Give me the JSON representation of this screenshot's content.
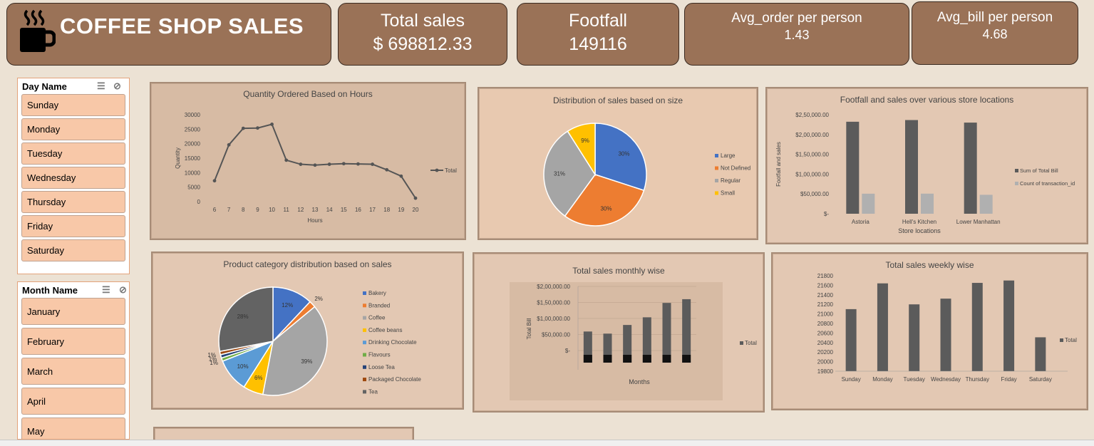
{
  "header": {
    "title": "COFFEE SHOP SALES",
    "kpis": [
      {
        "label": "Total sales",
        "value": "$ 698812.33"
      },
      {
        "label": "Footfall",
        "value": "149116"
      },
      {
        "label": "Avg_order per person",
        "value": "1.43"
      },
      {
        "label": "Avg_bill per person",
        "value": "4.68"
      }
    ]
  },
  "slicers": {
    "day": {
      "title": "Day Name",
      "items": [
        "Sunday",
        "Monday",
        "Tuesday",
        "Wednesday",
        "Thursday",
        "Friday",
        "Saturday"
      ]
    },
    "month": {
      "title": "Month Name",
      "items": [
        "January",
        "February",
        "March",
        "April",
        "May"
      ]
    }
  },
  "chart_data": [
    {
      "id": "hours",
      "type": "line",
      "title": "Quantity Ordered Based on Hours",
      "xlabel": "Hours",
      "ylabel": "Quantity",
      "x": [
        6,
        7,
        8,
        9,
        10,
        11,
        12,
        13,
        14,
        15,
        16,
        17,
        18,
        19,
        20
      ],
      "series": [
        {
          "name": "Total",
          "values": [
            7200,
            19600,
            25300,
            25400,
            26700,
            14300,
            12900,
            12600,
            12900,
            13100,
            13000,
            12900,
            11000,
            8800,
            1200
          ]
        }
      ],
      "ylim": [
        0,
        30000
      ],
      "yticks": [
        "30000",
        "25000",
        "20000",
        "15000",
        "10000",
        "5000",
        "0"
      ],
      "legend": "right"
    },
    {
      "id": "size",
      "type": "pie",
      "title": "Distribution of sales based on size",
      "categories": [
        "Large",
        "Not Defined",
        "Regular",
        "Small"
      ],
      "values": [
        30,
        30,
        31,
        9
      ],
      "labels": [
        "30%",
        "30%",
        "31%",
        "9%"
      ],
      "colors": [
        "#4472c4",
        "#ed7d31",
        "#a5a5a5",
        "#ffc000"
      ],
      "legend": "right"
    },
    {
      "id": "locations",
      "type": "bar",
      "title": "Footfall and sales over various store locations",
      "xlabel": "Store locations",
      "ylabel": "Footfall and sales",
      "categories": [
        "Astoria",
        "Hell's Kitchen",
        "Lower Manhattan"
      ],
      "series": [
        {
          "name": "Sum of Total Bill",
          "values": [
            232243.91,
            236511.17,
            230057.25
          ],
          "color": "#5b5b5b"
        },
        {
          "name": "Count of transaction_id",
          "values": [
            50599,
            50735,
            47782
          ],
          "color": "#b0b0b0"
        }
      ],
      "ylim": [
        0,
        250000
      ],
      "yticks": [
        "$2,50,000.00",
        "$2,00,000.00",
        "$1,50,000.00",
        "$1,00,000.00",
        "$50,000.00",
        "$-"
      ],
      "legend": "right"
    },
    {
      "id": "category",
      "type": "pie",
      "title": "Product category distribution based on sales",
      "categories": [
        "Bakery",
        "Branded",
        "Coffee",
        "Coffee beans",
        "Drinking Chocolate",
        "Flavours",
        "Loose Tea",
        "Packaged Chocolate",
        "Tea"
      ],
      "values": [
        12,
        2,
        39,
        6,
        10,
        1,
        1,
        1,
        28
      ],
      "labels": [
        "12%",
        "2%",
        "39%",
        "6%",
        "10%",
        "1%",
        "1%",
        "1%",
        "28%"
      ],
      "colors": [
        "#4472c4",
        "#ed7d31",
        "#a5a5a5",
        "#ffc000",
        "#5b9bd5",
        "#70ad47",
        "#264478",
        "#9e480e",
        "#636363"
      ],
      "legend": "right"
    },
    {
      "id": "monthly",
      "type": "bar",
      "title": "Total sales monthly wise",
      "xlabel": "Months",
      "ylabel": "Total Bill",
      "categories": [
        "",
        "",
        "",
        "",
        "",
        ""
      ],
      "series": [
        {
          "name": "Total",
          "values": [
            81678,
            76145,
            98834,
            118941,
            156728,
            166486
          ]
        }
      ],
      "ylim": [
        0,
        200000
      ],
      "yticks": [
        "$2,00,000.00",
        "$1,50,000.00",
        "$1,00,000.00",
        "$50,000.00",
        "$-"
      ],
      "legend": "right"
    },
    {
      "id": "weekly",
      "type": "bar",
      "title": "Total sales weekly wise",
      "categories": [
        "Sunday",
        "Monday",
        "Tuesday",
        "Wednesday",
        "Thursday",
        "Friday",
        "Saturday"
      ],
      "series": [
        {
          "name": "Total",
          "values": [
            21100,
            21640,
            21200,
            21320,
            21650,
            21700,
            20510
          ]
        }
      ],
      "ylim": [
        19800,
        21800
      ],
      "yticks": [
        "21800",
        "21600",
        "21400",
        "21200",
        "21000",
        "20800",
        "20600",
        "20400",
        "20200",
        "20000",
        "19800"
      ],
      "legend": "right"
    }
  ]
}
